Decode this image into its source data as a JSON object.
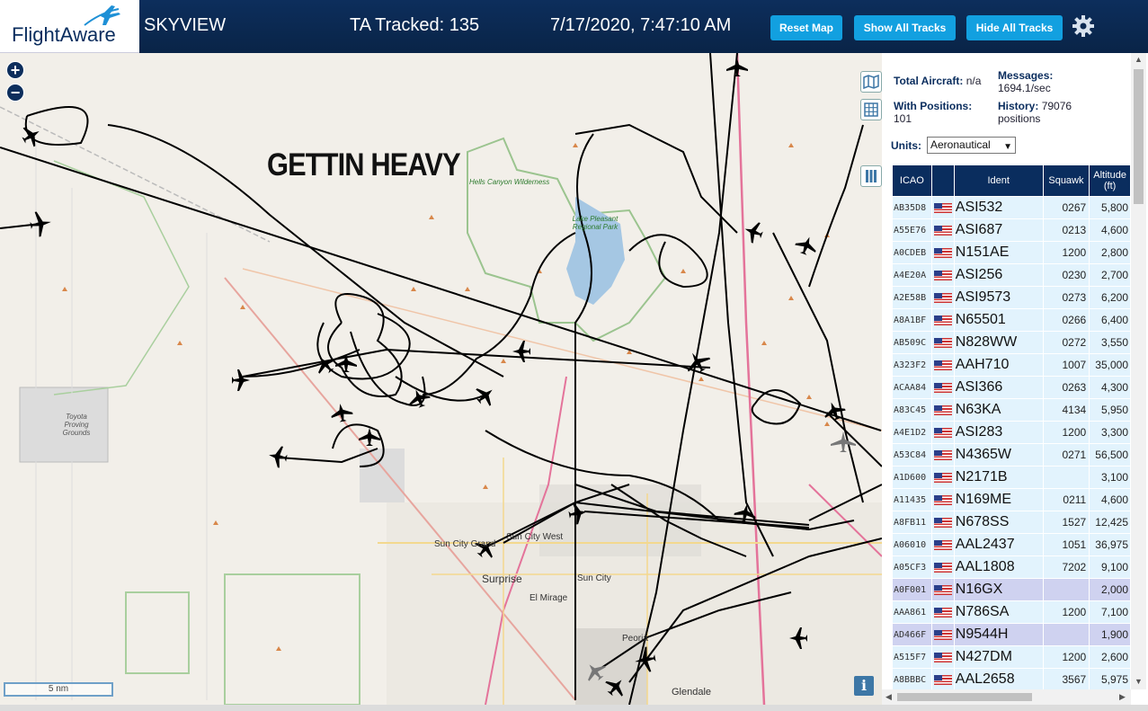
{
  "header": {
    "logo_text": "FlightAware",
    "app_name": "SKYVIEW",
    "tracked": "TA Tracked: 135",
    "datetime": "7/17/2020, 7:47:10 AM",
    "buttons": {
      "reset": "Reset Map",
      "show": "Show All Tracks",
      "hide": "Hide All Tracks"
    }
  },
  "map": {
    "overlay_text": "GETTIN HEAVY",
    "zoom_in": "+",
    "zoom_out": "−",
    "scale_label": "5 nm",
    "info": "i",
    "places": {
      "hells": "Hells Canyon Wilderness",
      "lake": "Lake Pleasant Regional Park",
      "toyota": "Toyota Proving Grounds",
      "suncity_grand": "Sun City Grand",
      "suncity_west": "Sun City West",
      "surprise": "Surprise",
      "suncity": "Sun City",
      "elmirage": "El Mirage",
      "peoria": "Peoria",
      "glendale": "Glendale"
    }
  },
  "sidebar": {
    "total_label": "Total Aircraft:",
    "total_value": "n/a",
    "messages_label": "Messages:",
    "messages_value": "1694.1/sec",
    "positions_label": "With Positions:",
    "positions_value": "101",
    "history_label": "History:",
    "history_value": "79076",
    "history_unit": "positions",
    "units_label": "Units:",
    "units_value": "Aeronautical",
    "columns": [
      "ICAO",
      "",
      "Ident",
      "Squawk",
      "Altitude (ft)"
    ],
    "rows": [
      {
        "icao": "AB35D8",
        "ident": "ASI532",
        "squawk": "0267",
        "alt": "5,800"
      },
      {
        "icao": "A55E76",
        "ident": "ASI687",
        "squawk": "0213",
        "alt": "4,600"
      },
      {
        "icao": "A0CDEB",
        "ident": "N151AE",
        "squawk": "1200",
        "alt": "2,800"
      },
      {
        "icao": "A4E20A",
        "ident": "ASI256",
        "squawk": "0230",
        "alt": "2,700"
      },
      {
        "icao": "A2E58B",
        "ident": "ASI9573",
        "squawk": "0273",
        "alt": "6,200"
      },
      {
        "icao": "A8A1BF",
        "ident": "N65501",
        "squawk": "0266",
        "alt": "6,400"
      },
      {
        "icao": "AB509C",
        "ident": "N828WW",
        "squawk": "0272",
        "alt": "3,550"
      },
      {
        "icao": "A323F2",
        "ident": "AAH710",
        "squawk": "1007",
        "alt": "35,000"
      },
      {
        "icao": "ACAA84",
        "ident": "ASI366",
        "squawk": "0263",
        "alt": "4,300"
      },
      {
        "icao": "A83C45",
        "ident": "N63KA",
        "squawk": "4134",
        "alt": "5,950"
      },
      {
        "icao": "A4E1D2",
        "ident": "ASI283",
        "squawk": "1200",
        "alt": "3,300"
      },
      {
        "icao": "A53C84",
        "ident": "N4365W",
        "squawk": "0271",
        "alt": "56,500"
      },
      {
        "icao": "A1D600",
        "ident": "N2171B",
        "squawk": "",
        "alt": "3,100"
      },
      {
        "icao": "A11435",
        "ident": "N169ME",
        "squawk": "0211",
        "alt": "4,600"
      },
      {
        "icao": "A8FB11",
        "ident": "N678SS",
        "squawk": "1527",
        "alt": "12,425"
      },
      {
        "icao": "A06010",
        "ident": "AAL2437",
        "squawk": "1051",
        "alt": "36,975"
      },
      {
        "icao": "A05CF3",
        "ident": "AAL1808",
        "squawk": "7202",
        "alt": "9,100"
      },
      {
        "icao": "A0F001",
        "ident": "N16GX",
        "squawk": "",
        "alt": "2,000",
        "selected": true
      },
      {
        "icao": "AAA861",
        "ident": "N786SA",
        "squawk": "1200",
        "alt": "7,100"
      },
      {
        "icao": "AD466F",
        "ident": "N9544H",
        "squawk": "",
        "alt": "1,900",
        "selected": true
      },
      {
        "icao": "A515F7",
        "ident": "N427DM",
        "squawk": "1200",
        "alt": "2,600"
      },
      {
        "icao": "A8BBBC",
        "ident": "AAL2658",
        "squawk": "3567",
        "alt": "5,975"
      }
    ]
  }
}
